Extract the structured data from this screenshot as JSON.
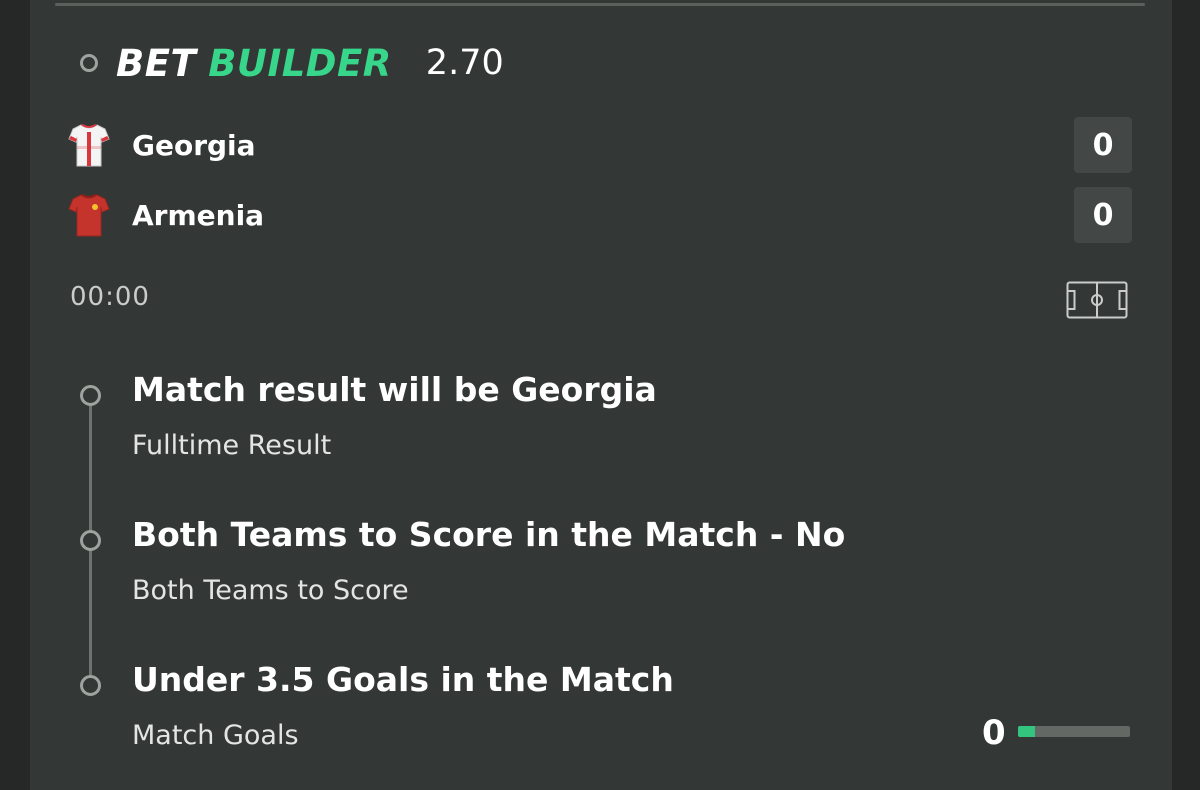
{
  "header": {
    "bet_word": "BET",
    "builder_word": "BUILDER",
    "odds": "2.70",
    "accent_color": "#37d68b"
  },
  "teams": [
    {
      "name": "Georgia",
      "score": "0",
      "kit_icon": "white-shirt-icon"
    },
    {
      "name": "Armenia",
      "score": "0",
      "kit_icon": "red-shirt-icon"
    }
  ],
  "clock": "00:00",
  "pitch_icon": "pitch-icon",
  "selections": [
    {
      "title": "Match result will be Georgia",
      "market": "Fulltime Result"
    },
    {
      "title": "Both Teams to Score in the Match - No",
      "market": "Both Teams to Score"
    },
    {
      "title": "Under 3.5 Goals in the Match",
      "market": "Match Goals"
    }
  ],
  "goals_tracker": {
    "count": "0",
    "progress_fraction": 0.15,
    "bar_color": "#33c47f"
  }
}
